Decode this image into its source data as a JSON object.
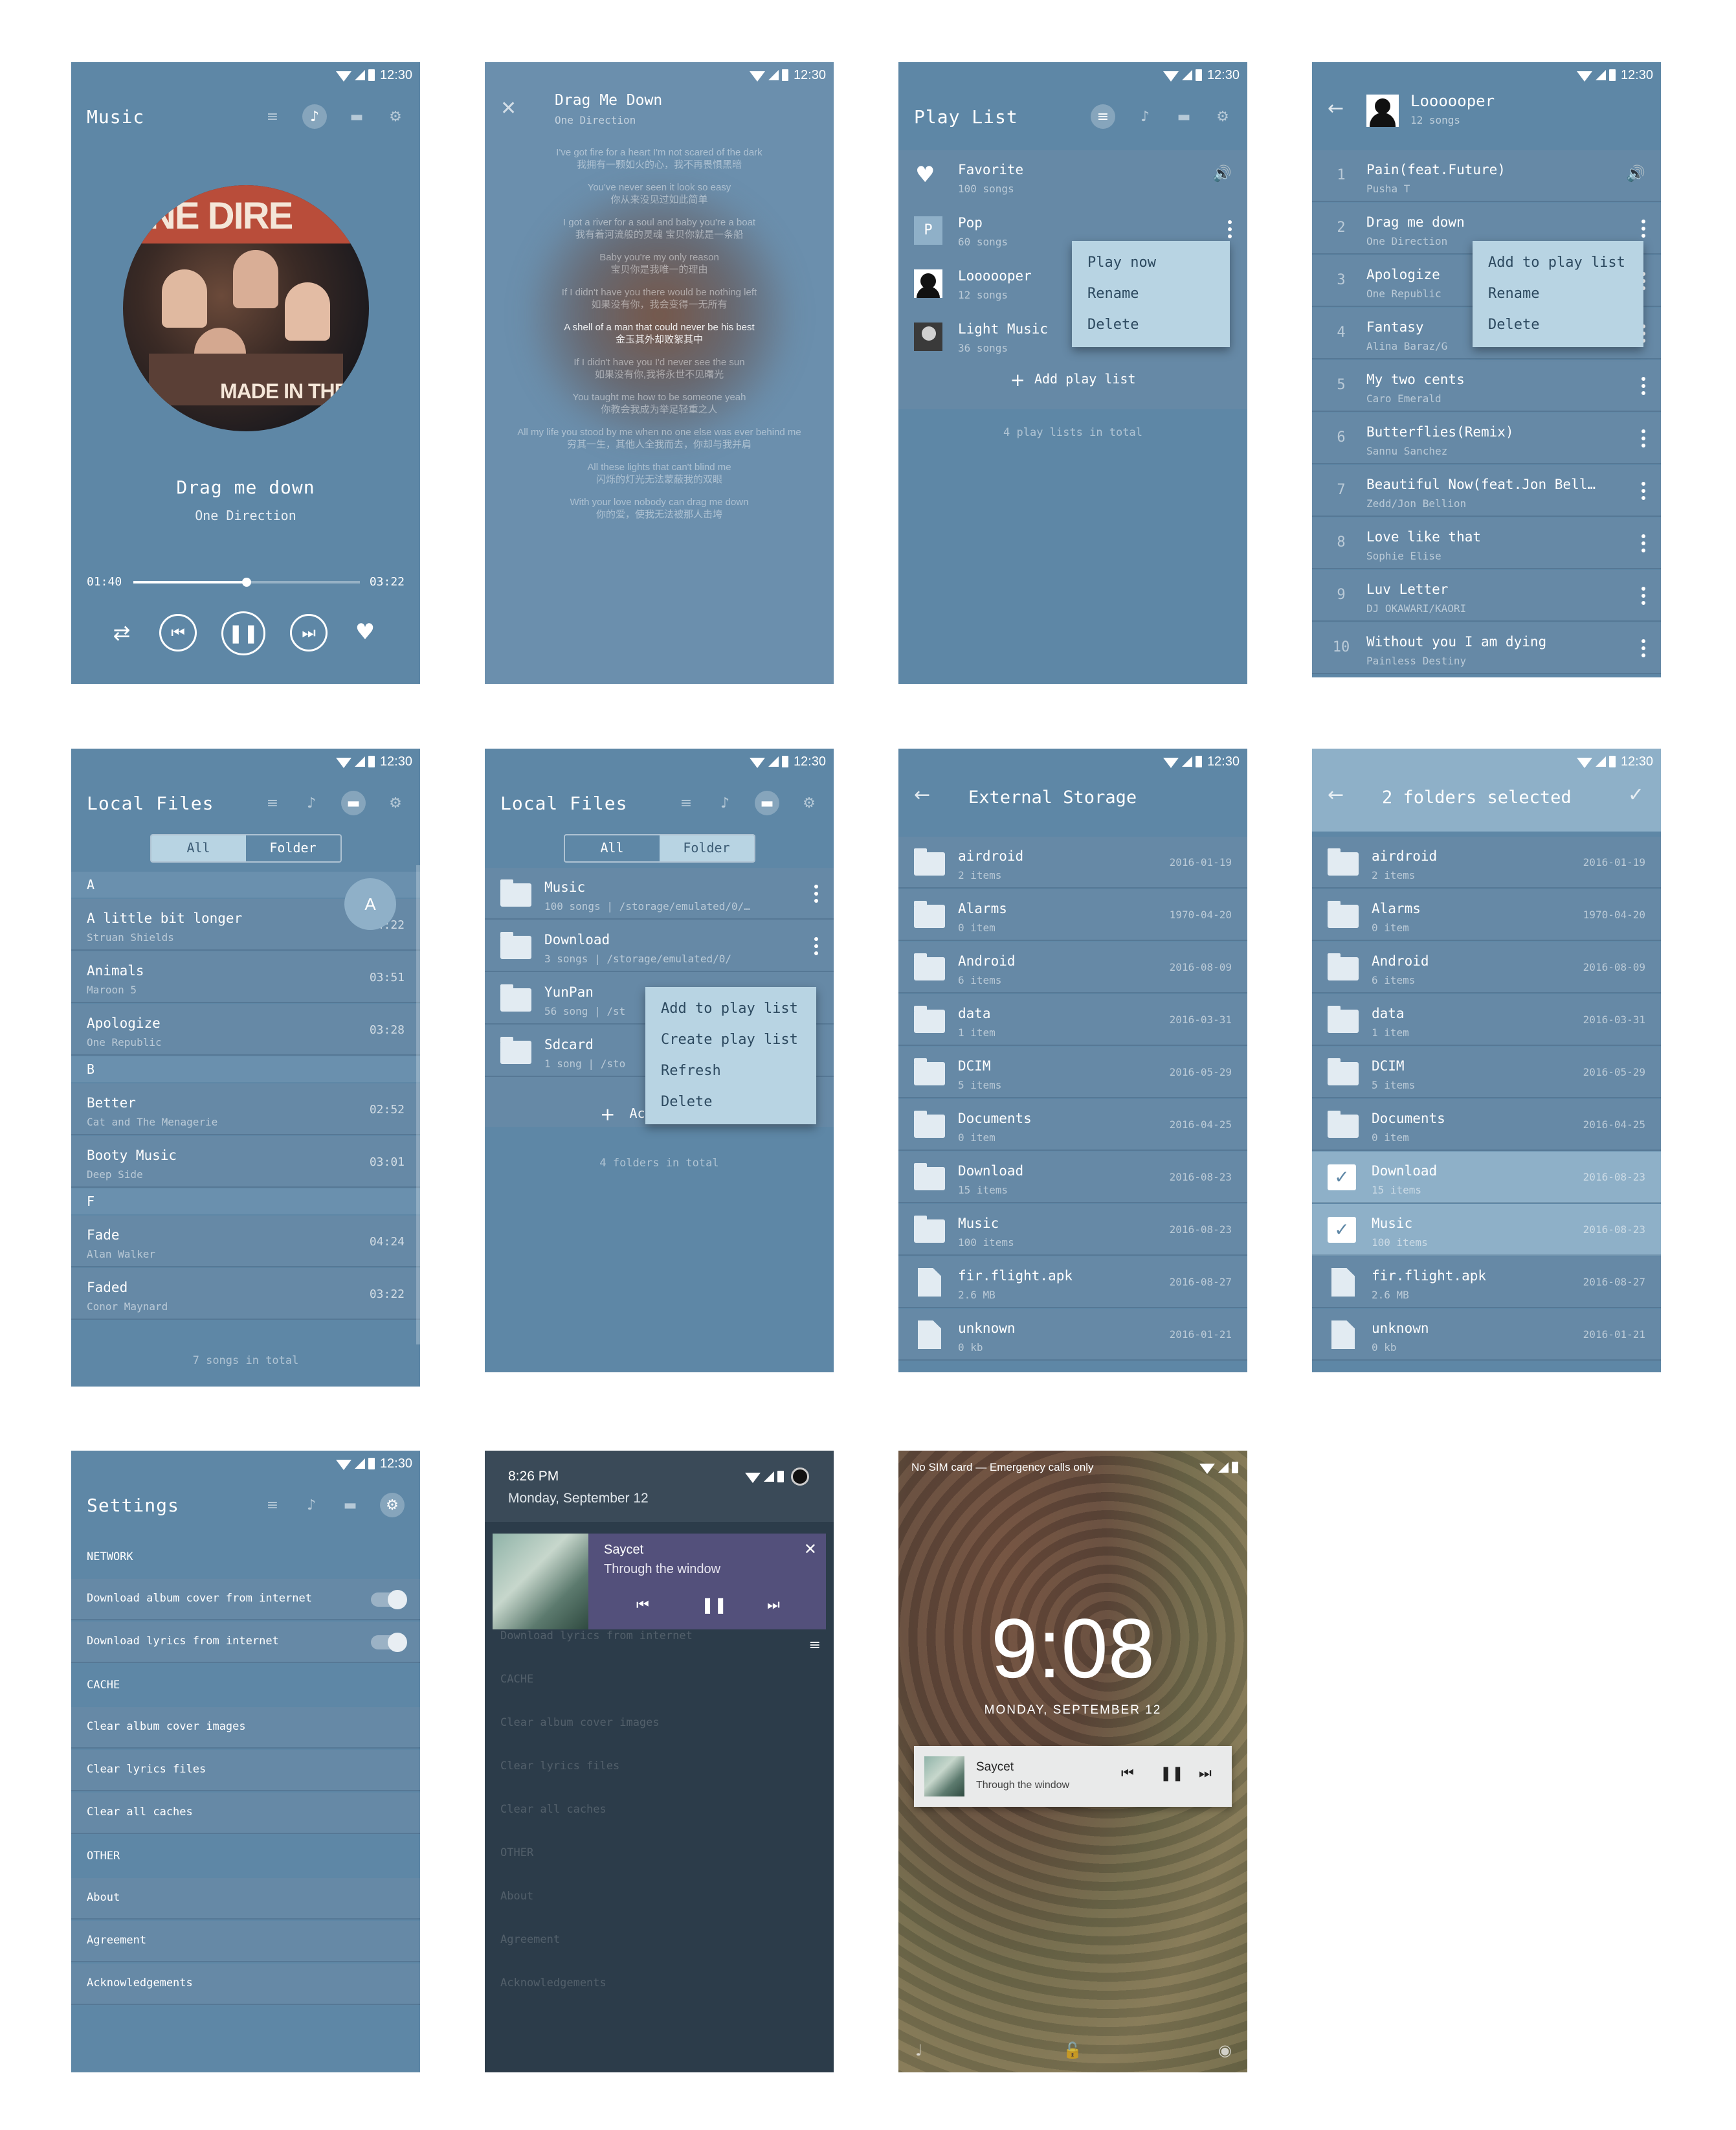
{
  "status_time": "12:30",
  "s1": {
    "title": "Music",
    "track_title": "Drag me down",
    "track_artist": "One Direction",
    "elapsed": "01:40",
    "duration": "03:22",
    "progress": 0.5,
    "album_text_top": "NE DIRE",
    "album_text_bottom": "MADE IN THE A"
  },
  "s2": {
    "title": "Drag Me Down",
    "subtitle": "One Direction",
    "lyrics": [
      [
        "I've got fire for a heart I'm not scared of the dark",
        "我拥有一颗如火的心，我不再畏惧黑暗"
      ],
      [
        "You've never seen it look so easy",
        "你从来没见过如此简单"
      ],
      [
        "I got a river for a soul and baby you're a boat",
        "我有着河流般的灵魂 宝贝你就是一条船"
      ],
      [
        "Baby you're my only reason",
        "宝贝你是我唯一的理由"
      ],
      [
        "If I didn't have you there would be nothing left",
        "如果没有你，我会变得一无所有"
      ],
      [
        "A shell of a man that could never be his best",
        "金玉其外却败絮其中"
      ],
      [
        "If I didn't have you I'd never see the sun",
        "如果没有你,我将永世不见曙光"
      ],
      [
        "You taught me how to be someone yeah",
        "你教会我成为举足轻重之人"
      ],
      [
        "All my life you stood by me when no one else was ever behind me",
        "穷其一生，其他人全我而去，你却与我并肩"
      ],
      [
        "All these lights that can't blind me",
        "闪烁的灯光无法蒙蔽我的双眼"
      ],
      [
        "With your love nobody can drag me down",
        "你的爱，使我无法被那人击垮"
      ]
    ]
  },
  "s3": {
    "title": "Play List",
    "lists": [
      {
        "name": "Favorite",
        "count": "100 songs"
      },
      {
        "name": "Pop",
        "count": "60 songs",
        "letter": "P"
      },
      {
        "name": "Loooooper",
        "count": "12 songs"
      },
      {
        "name": "Light Music",
        "count": "36 songs"
      }
    ],
    "menu": [
      "Play now",
      "Rename",
      "Delete"
    ],
    "add_label": "Add play list",
    "total": "4 play lists in total"
  },
  "s4": {
    "title": "Loooooper",
    "subtitle": "12 songs",
    "songs": [
      {
        "n": "1",
        "title": "Pain(feat.Future)",
        "artist": "Pusha T"
      },
      {
        "n": "2",
        "title": "Drag me down",
        "artist": "One Direction"
      },
      {
        "n": "3",
        "title": "Apologize",
        "artist": "One Republic"
      },
      {
        "n": "4",
        "title": "Fantasy",
        "artist": "Alina Baraz/G"
      },
      {
        "n": "5",
        "title": "My two cents",
        "artist": "Caro Emerald"
      },
      {
        "n": "6",
        "title": "Butterflies(Remix)",
        "artist": "Sannu Sanchez"
      },
      {
        "n": "7",
        "title": "Beautiful Now(feat.Jon Bell…",
        "artist": "Zedd/Jon Bellion"
      },
      {
        "n": "8",
        "title": "Love like that",
        "artist": "Sophie Elise"
      },
      {
        "n": "9",
        "title": "Luv Letter",
        "artist": "DJ OKAWARI/KAORI"
      },
      {
        "n": "10",
        "title": "Without you I am dying",
        "artist": "Painless Destiny"
      }
    ],
    "menu": [
      "Add to play list",
      "Rename",
      "Delete"
    ]
  },
  "s5": {
    "title": "Local Files",
    "seg": [
      "All",
      "Folder"
    ],
    "bubble": "A",
    "sections": [
      {
        "letter": "A",
        "songs": [
          {
            "title": "A little bit longer",
            "artist": "Struan Shields",
            "dur": "04:22"
          },
          {
            "title": "Animals",
            "artist": "Maroon 5",
            "dur": "03:51"
          },
          {
            "title": "Apologize",
            "artist": "One Republic",
            "dur": "03:28"
          }
        ]
      },
      {
        "letter": "B",
        "songs": [
          {
            "title": "Better",
            "artist": "Cat and The Menagerie",
            "dur": "02:52"
          },
          {
            "title": "Booty Music",
            "artist": "Deep Side",
            "dur": "03:01"
          }
        ]
      },
      {
        "letter": "F",
        "songs": [
          {
            "title": "Fade",
            "artist": "Alan Walker",
            "dur": "04:24"
          },
          {
            "title": "Faded",
            "artist": "Conor Maynard",
            "dur": "03:22"
          }
        ]
      }
    ],
    "total": "7 songs in total"
  },
  "s6": {
    "title": "Local Files",
    "seg": [
      "All",
      "Folder"
    ],
    "folders": [
      {
        "name": "Music",
        "info": "100 songs | /storage/emulated/0/…"
      },
      {
        "name": "Download",
        "info": "3 songs | /storage/emulated/0/"
      },
      {
        "name": "YunPan",
        "info": "56 song | /st"
      },
      {
        "name": "Sdcard",
        "info": "1 song | /sto"
      }
    ],
    "menu": [
      "Add to play list",
      "Create play list",
      "Refresh",
      "Delete"
    ],
    "add_label": "Ac",
    "total": "4 folders in total"
  },
  "s7": {
    "title": "External Storage",
    "items": [
      {
        "name": "airdroid",
        "info": "2 items",
        "date": "2016-01-19",
        "kind": "folder"
      },
      {
        "name": "Alarms",
        "info": "0 item",
        "date": "1970-04-20",
        "kind": "folder"
      },
      {
        "name": "Android",
        "info": "6 items",
        "date": "2016-08-09",
        "kind": "folder"
      },
      {
        "name": "data",
        "info": "1 item",
        "date": "2016-03-31",
        "kind": "folder"
      },
      {
        "name": "DCIM",
        "info": "5 items",
        "date": "2016-05-29",
        "kind": "folder"
      },
      {
        "name": "Documents",
        "info": "0 item",
        "date": "2016-04-25",
        "kind": "folder"
      },
      {
        "name": "Download",
        "info": "15 items",
        "date": "2016-08-23",
        "kind": "folder"
      },
      {
        "name": "Music",
        "info": "100 items",
        "date": "2016-08-23",
        "kind": "folder"
      },
      {
        "name": "fir.flight.apk",
        "info": "2.6 MB",
        "date": "2016-08-27",
        "kind": "file"
      },
      {
        "name": "unknown",
        "info": "0 kb",
        "date": "2016-01-21",
        "kind": "file"
      }
    ]
  },
  "s8": {
    "title": "2 folders selected",
    "selected": [
      6,
      7
    ]
  },
  "s9": {
    "title": "Settings",
    "groups": [
      {
        "header": "NETWORK",
        "items": [
          "Download album cover from internet",
          "Download lyrics from internet"
        ],
        "toggles": true
      },
      {
        "header": "CACHE",
        "items": [
          "Clear album cover images",
          "Clear lyrics files",
          "Clear all caches"
        ],
        "toggles": false
      },
      {
        "header": "OTHER",
        "items": [
          "About",
          "Agreement",
          "Acknowledgements"
        ],
        "toggles": false
      }
    ]
  },
  "s10": {
    "time": "8:26 PM",
    "date": "Monday, September 12",
    "song": "Saycet",
    "subtitle": "Through the window",
    "bg_items": [
      "Download lyrics from internet",
      "CACHE",
      "Clear album cover images",
      "Clear lyrics files",
      "Clear all caches",
      "OTHER",
      "About",
      "Agreement",
      "Acknowledgements"
    ]
  },
  "s11": {
    "carrier": "No SIM card — Emergency calls only",
    "clock": "9:08",
    "date": "MONDAY, SEPTEMBER 12",
    "song": "Saycet",
    "subtitle": "Through the window"
  }
}
